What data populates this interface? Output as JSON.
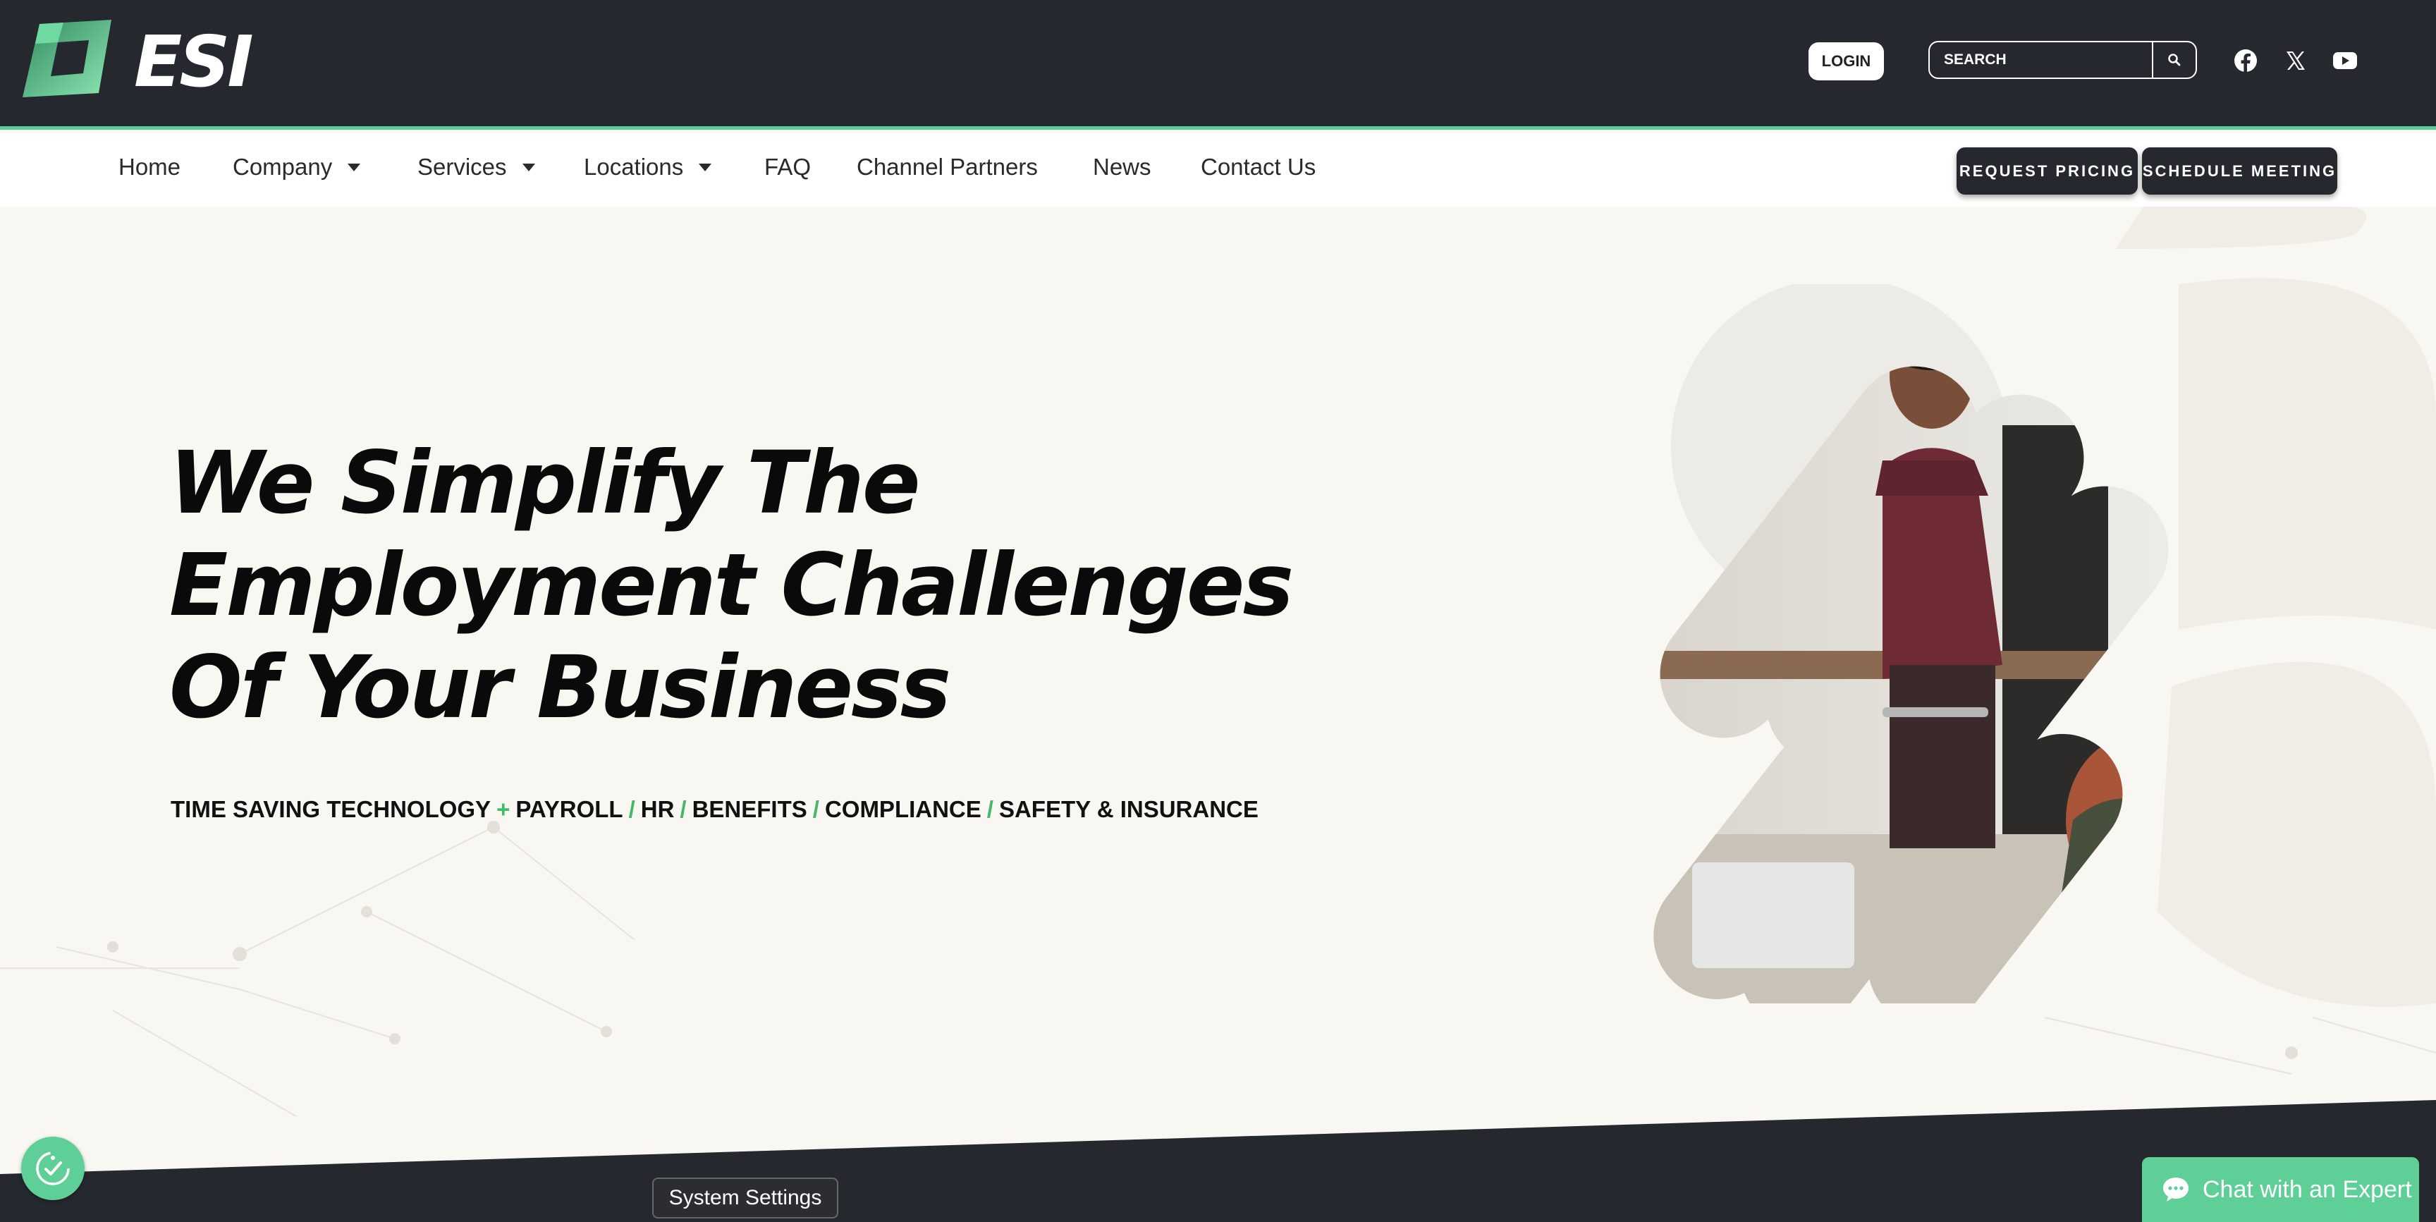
{
  "brand": {
    "logo_text": "ESI",
    "accent_color": "#5fcf98",
    "dark_color": "#25282e"
  },
  "header": {
    "login_label": "LOGIN",
    "search_placeholder": "SEARCH",
    "social": [
      "facebook-icon",
      "x-icon",
      "youtube-icon"
    ]
  },
  "nav": {
    "items": [
      {
        "label": "Home",
        "dropdown": false
      },
      {
        "label": "Company",
        "dropdown": true
      },
      {
        "label": "Services",
        "dropdown": true
      },
      {
        "label": "Locations",
        "dropdown": true
      },
      {
        "label": "FAQ",
        "dropdown": false
      },
      {
        "label": "Channel Partners",
        "dropdown": false
      },
      {
        "label": "News",
        "dropdown": false
      },
      {
        "label": "Contact Us",
        "dropdown": false
      }
    ],
    "cta_pricing": "REQUEST PRICING",
    "cta_meeting": "SCHEDULE MEETING"
  },
  "hero": {
    "headline_line1": "We Simplify The",
    "headline_line2": "Employment Challenges",
    "headline_line3": "Of Your Business",
    "tagline": {
      "t1": "TIME SAVING TECHNOLOGY",
      "s1": "+",
      "t2": "PAYROLL",
      "s2": "/",
      "t3": "HR",
      "s3": "/",
      "t4": "BENEFITS",
      "s4": "/",
      "t5": "COMPLIANCE",
      "s5": "/",
      "t6": "SAFETY & INSURANCE"
    }
  },
  "overlay": {
    "system_settings": "System Settings",
    "chat_label": "Chat with an Expert"
  }
}
